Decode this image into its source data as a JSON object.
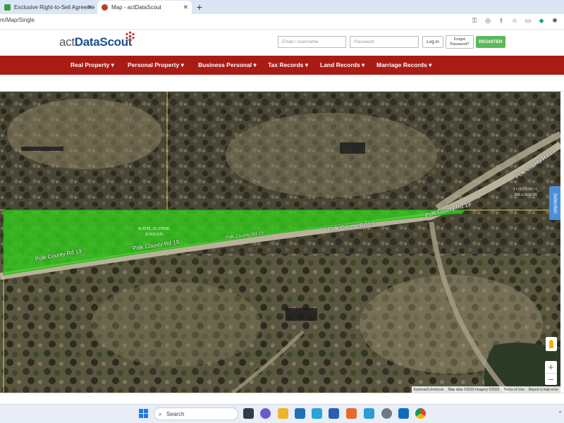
{
  "browser": {
    "tabs": [
      {
        "title": "Exclusive Right-to-Sell Agreeme",
        "icon": "sheet-icon",
        "color": "#3c9a47"
      },
      {
        "title": "Map - actDataScout",
        "icon": "datascout-icon",
        "color": "#c0392b"
      }
    ],
    "new_tab": "+",
    "url": "m/Map/Single"
  },
  "site": {
    "logo_prefix": "act",
    "logo_brand": "DataScout",
    "email_placeholder": "Email / Username",
    "password_placeholder": "Password",
    "login_label": "Log in",
    "forgot_line1": "Forgot",
    "forgot_line2": "Password?",
    "register_label": "REGISTER",
    "nav": [
      "Real Property ▾",
      "Personal Property ▾",
      "Business Personal ▾",
      "Tax Records ▾",
      "Land Records ▾",
      "Marriage Records ▾"
    ]
  },
  "map": {
    "road_labels": [
      "Polk County Rd 19",
      "Polk County Rd 19",
      "Polk County Rd 19",
      "Polk County Rd 19",
      "Polk County Rd 19",
      "Polk County Rd 19"
    ],
    "owner_line1": "RATH, JEANNE",
    "owner_line2": "JORDAN",
    "owner2_line1": "FONTENOT,",
    "owner2_line2": "BRANDON",
    "selection_label": "Selection",
    "zoom_in": "+",
    "zoom_out": "−",
    "attribution": [
      "Keyboard shortcuts",
      "Map data ©2023 Imagery ©2023",
      "Terms of Use",
      "Report a map error"
    ],
    "parcel_color": "#33d11c"
  },
  "taskbar": {
    "search_label": "Search"
  }
}
